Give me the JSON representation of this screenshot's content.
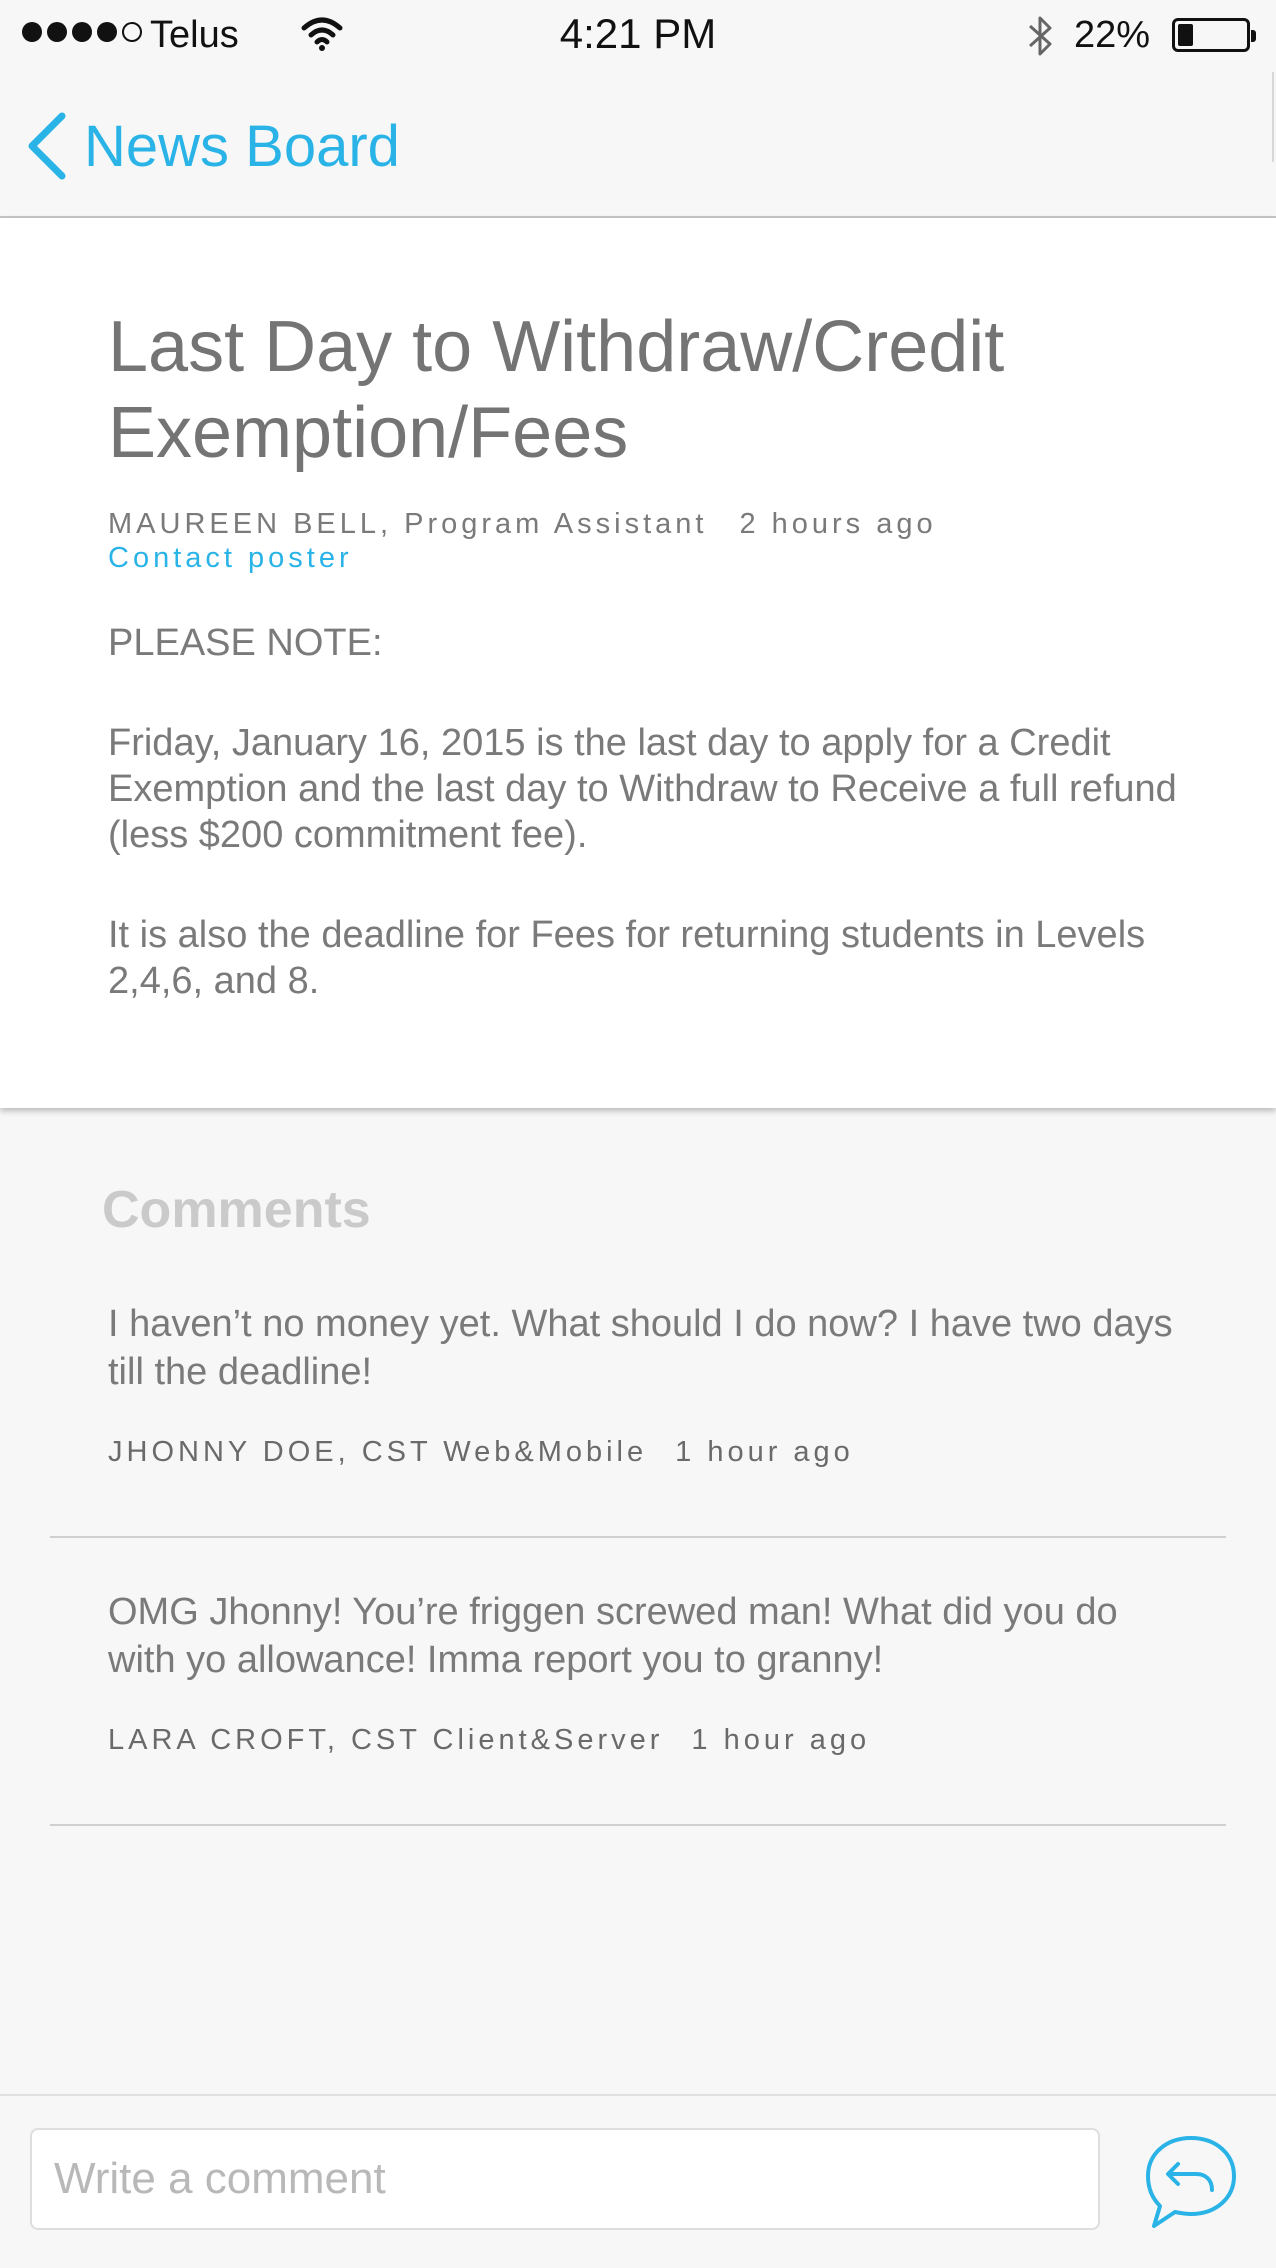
{
  "status_bar": {
    "carrier": "Telus",
    "time": "4:21 PM",
    "battery_percent": "22%",
    "battery_level": 0.22,
    "signal_bars": 4,
    "signal_total": 5
  },
  "nav": {
    "back_label": "News Board",
    "accent_color": "#2ab3e6"
  },
  "post": {
    "title": "Last Day to Withdraw/Credit Exemption/Fees",
    "author": "MAUREEN BELL, Program Assistant",
    "time": "2 hours ago",
    "contact_label": "Contact poster",
    "body": [
      "PLEASE NOTE:",
      "Friday, January 16, 2015 is the last day to apply for a Credit Exemption and the last day to Withdraw to Receive a full refund (less $200 commitment fee).",
      "It is also the deadline for Fees for returning students in Levels 2,4,6, and 8."
    ]
  },
  "comments": {
    "heading": "Comments",
    "items": [
      {
        "text": "I haven’t no money yet. What should I do now? I have two days till the deadline!",
        "author": "JHONNY DOE, CST Web&Mobile",
        "time": "1 hour ago"
      },
      {
        "text": "OMG Jhonny! You’re friggen screwed man! What did you do with yo allowance! Imma report you to granny!",
        "author": "LARA CROFT, CST Client&Server",
        "time": "1 hour ago"
      }
    ]
  },
  "composer": {
    "placeholder": "Write a comment",
    "value": "",
    "reply_icon": "reply-chat-bubble-icon"
  }
}
